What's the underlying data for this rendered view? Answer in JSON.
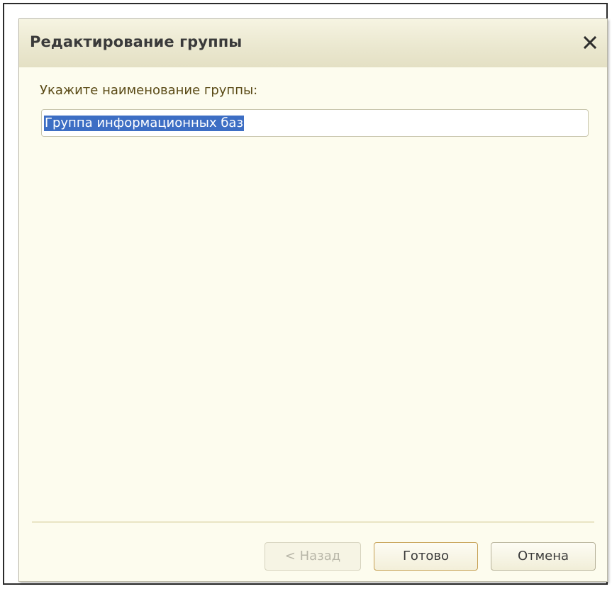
{
  "window": {
    "title": "Редактирование группы",
    "close_icon": "close-icon"
  },
  "form": {
    "prompt": "Укажите наименование группы:",
    "name_value": "Группа информационных баз"
  },
  "buttons": {
    "back_label": "< Назад",
    "done_label": "Готово",
    "cancel_label": "Отмена"
  },
  "colors": {
    "dialog_background": "#fdfcee",
    "selection": "#3d6ec4",
    "label_text": "#5a4a16",
    "default_button_border": "#c59f52"
  }
}
